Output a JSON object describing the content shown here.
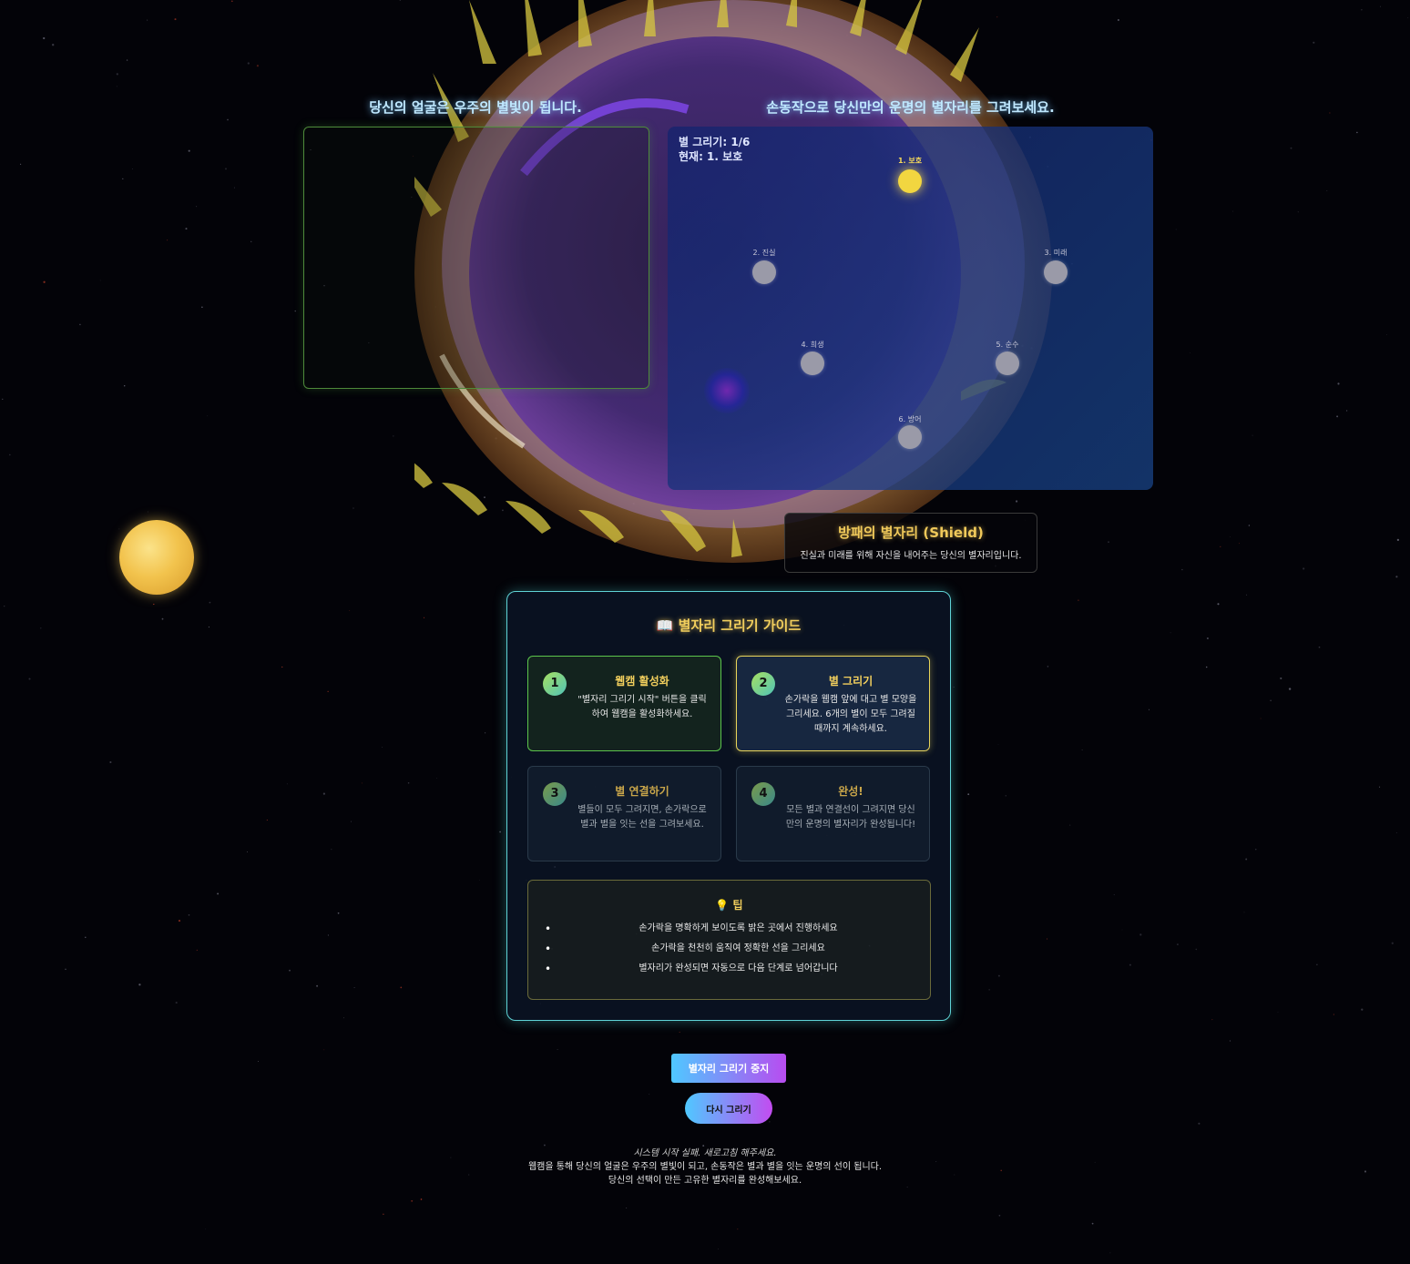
{
  "panels": {
    "left_title": "당신의 얼굴은 우주의 별빛이 됩니다.",
    "right_title": "손동작으로 당신만의 운명의 별자리를 그려보세요."
  },
  "canvas": {
    "progress_text": "별 그리기: 1/6",
    "current_text": "현재: 1. 보호",
    "stars": [
      {
        "label": "1. 보호",
        "active": true
      },
      {
        "label": "2. 진실",
        "active": false
      },
      {
        "label": "3. 미래",
        "active": false
      },
      {
        "label": "4. 희생",
        "active": false
      },
      {
        "label": "5. 순수",
        "active": false
      },
      {
        "label": "6. 방어",
        "active": false
      }
    ]
  },
  "constellation": {
    "title": "방패의 별자리 (Shield)",
    "description": "진실과 미래를 위해 자신을 내어주는 당신의 별자리입니다."
  },
  "guide": {
    "title": "📖 별자리 그리기 가이드",
    "steps": [
      {
        "num": "1",
        "title": "웹캠 활성화",
        "desc": "\"별자리 그리기 시작\" 버튼을 클릭하여 웹캠을 활성화하세요."
      },
      {
        "num": "2",
        "title": "별 그리기",
        "desc": "손가락을 웹캠 앞에 대고 별 모양을 그리세요. 6개의 별이 모두 그려질 때까지 계속하세요."
      },
      {
        "num": "3",
        "title": "별 연결하기",
        "desc": "별들이 모두 그려지면, 손가락으로 별과 별을 잇는 선을 그려보세요."
      },
      {
        "num": "4",
        "title": "완성!",
        "desc": "모든 별과 연결선이 그려지면 당신만의 운명의 별자리가 완성됩니다!"
      }
    ],
    "tips_title": "💡 팁",
    "tips": [
      "손가락을 명확하게 보이도록 밝은 곳에서 진행하세요",
      "손가락을 천천히 움직여 정확한 선을 그리세요",
      "별자리가 완성되면 자동으로 다음 단계로 넘어갑니다"
    ]
  },
  "buttons": {
    "stop": "별자리 그리기 중지",
    "redraw": "다시 그리기"
  },
  "footer": {
    "error": "시스템 시작 실패. 새로고침 해주세요.",
    "line1": "웹캠을 통해 당신의 얼굴은 우주의 별빛이 되고, 손동작은 별과 별을 잇는 운명의 선이 됩니다.",
    "line2": "당신의 선택이 만든 고유한 별자리를 완성해보세요."
  },
  "colors": {
    "background": "#030308",
    "accent_gold": "#f2cf5d",
    "accent_cyan": "#5fd3d6",
    "active_star": "#f2d640"
  }
}
